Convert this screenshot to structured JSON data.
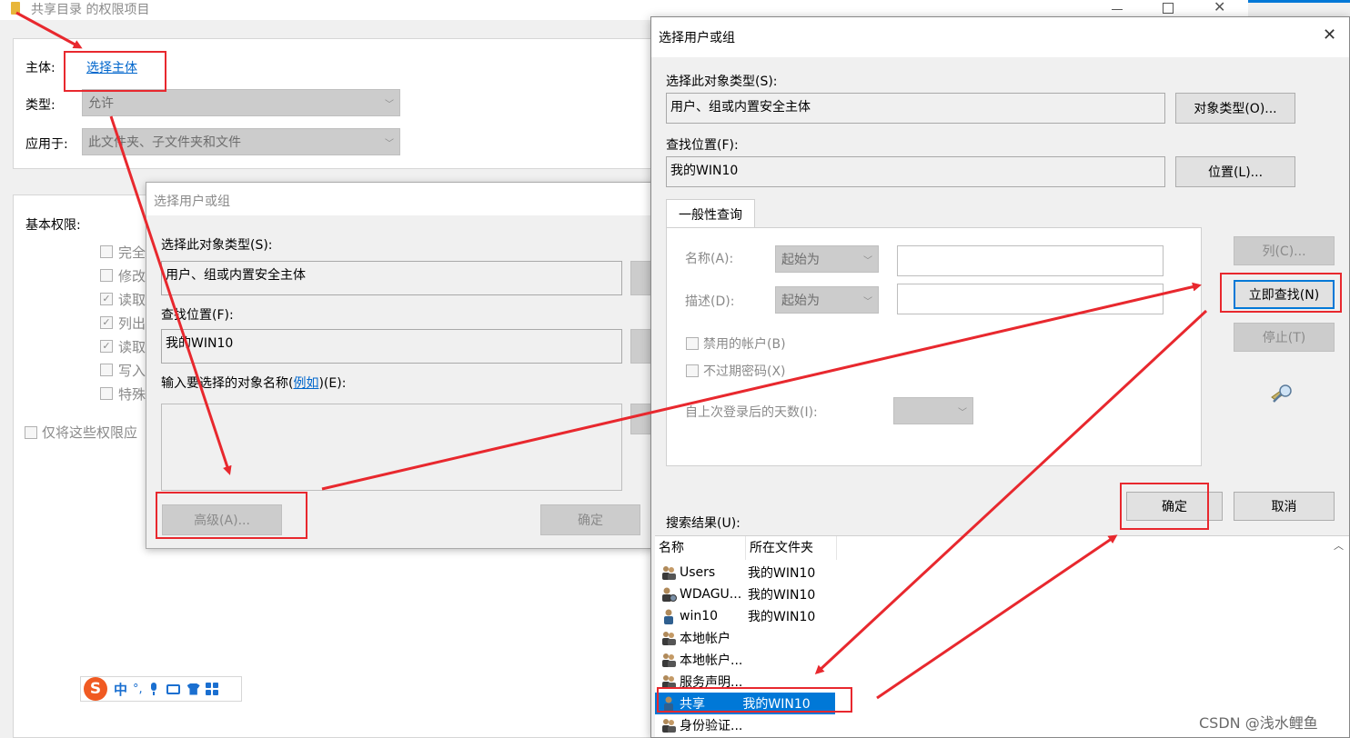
{
  "bg_window": {
    "title": "共享目录 的权限项目",
    "principal_label": "主体:",
    "principal_link": "选择主体",
    "type_label": "类型:",
    "type_value": "允许",
    "apply_label": "应用于:",
    "apply_value": "此文件夹、子文件夹和文件",
    "basic_label": "基本权限:",
    "perms": [
      {
        "label": "完全",
        "checked": false
      },
      {
        "label": "修改",
        "checked": false
      },
      {
        "label": "读取",
        "checked": true
      },
      {
        "label": "列出",
        "checked": true
      },
      {
        "label": "读取",
        "checked": true
      },
      {
        "label": "写入",
        "checked": false
      },
      {
        "label": "特殊",
        "checked": false
      }
    ],
    "only_apply_label": "仅将这些权限应"
  },
  "mid_dialog": {
    "title": "选择用户或组",
    "obj_type_label": "选择此对象类型(S):",
    "obj_type_value": "用户、组或内置安全主体",
    "location_label": "查找位置(F):",
    "location_value": "我的WIN10",
    "enter_label": "输入要选择的对象名称(",
    "enter_link": "例如",
    "enter_suffix": ")(E):",
    "advanced_button": "高级(A)...",
    "ok_button": "确定"
  },
  "main_dialog": {
    "title": "选择用户或组",
    "close_glyph": "✕",
    "obj_type_label": "选择此对象类型(S):",
    "obj_type_value": "用户、组或内置安全主体",
    "obj_type_button": "对象类型(O)...",
    "location_label": "查找位置(F):",
    "location_value": "我的WIN10",
    "location_button": "位置(L)...",
    "tab_label": "一般性查询",
    "name_label": "名称(A):",
    "name_mode": "起始为",
    "desc_label": "描述(D):",
    "desc_mode": "起始为",
    "disabled_accounts": "禁用的帐户(B)",
    "no_expire": "不过期密码(X)",
    "days_label": "自上次登录后的天数(I):",
    "columns_button": "列(C)...",
    "find_now_button": "立即查找(N)",
    "stop_button": "停止(T)",
    "ok_button": "确定",
    "cancel_button": "取消",
    "results_label": "搜索结果(U):",
    "col_name": "名称",
    "col_folder": "所在文件夹",
    "results": [
      {
        "name": "Users",
        "folder": "我的WIN10",
        "icon": "group-icon",
        "selected": false
      },
      {
        "name": "WDAGU...",
        "folder": "我的WIN10",
        "icon": "user-gear-icon",
        "selected": false
      },
      {
        "name": "win10",
        "folder": "我的WIN10",
        "icon": "user-icon",
        "selected": false
      },
      {
        "name": "本地帐户",
        "folder": "",
        "icon": "group-icon",
        "selected": false
      },
      {
        "name": "本地帐户...",
        "folder": "",
        "icon": "group-icon",
        "selected": false
      },
      {
        "name": "服务声明...",
        "folder": "",
        "icon": "group-icon",
        "selected": false
      },
      {
        "name": "共享",
        "folder": "我的WIN10",
        "icon": "user-icon",
        "selected": true
      },
      {
        "name": "身份验证...",
        "folder": "",
        "icon": "group-icon",
        "selected": false
      }
    ]
  },
  "ime_toolbar": {
    "logo": "S",
    "mode": "中",
    "punct": "°,"
  },
  "watermark": "CSDN @浅水鲤鱼",
  "colors": {
    "annotation_red": "#e8282e",
    "selection_blue": "#0078d7",
    "link_blue": "#0066cc"
  }
}
